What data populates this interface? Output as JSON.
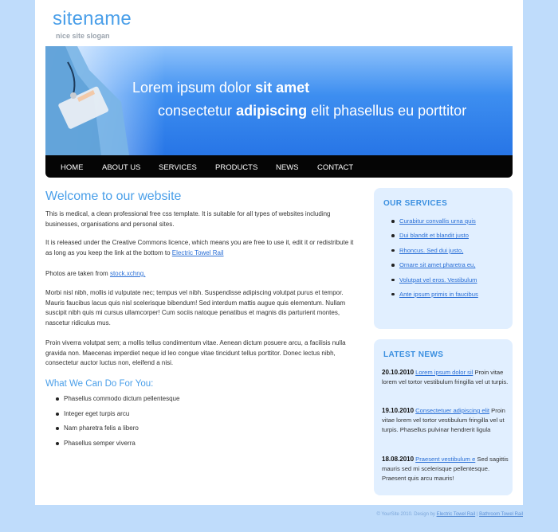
{
  "header": {
    "site_name": "sitename",
    "slogan": "nice site slogan"
  },
  "banner": {
    "line1_prefix": "Lorem ipsum dolor ",
    "line1_bold": "sit amet",
    "line2_prefix": "consectetur ",
    "line2_bold": "adipiscing",
    "line2_suffix": " elit phasellus eu porttitor"
  },
  "nav": {
    "items": [
      "HOME",
      "ABOUT US",
      "SERVICES",
      "PRODUCTS",
      "NEWS",
      "CONTACT"
    ]
  },
  "main": {
    "title": "Welcome to our website",
    "p1": "This is medical, a clean professional free css template. It is suitable for all types of websites including businesses, organisations and personal sites.",
    "p2_text": "It is released under the Creative Commons licence, which means you are free to use it, edit it or redistribute it as long as you keep the link at the bottom to ",
    "p2_link": "Electric Towel Rail",
    "p3_text": "Photos are taken from ",
    "p3_link": "stock.xchng.",
    "p4": "Morbi nisl nibh, mollis id vulputate nec; tempus vel nibh. Suspendisse adipiscing volutpat purus et tempor. Mauris faucibus lacus quis nisl scelerisque bibendum! Sed interdum mattis augue quis elementum. Nullam suscipit nibh quis mi cursus ullamcorper! Cum sociis natoque penatibus et magnis dis parturient montes, nascetur ridiculus mus.",
    "p5": "Proin viverra volutpat sem; a mollis tellus condimentum vitae. Aenean dictum posuere arcu, a facilisis nulla gravida non. Maecenas imperdiet neque id leo congue vitae tincidunt tellus porttitor. Donec lectus nibh, consectetur auctor luctus non, eleifend a nisi.",
    "subhead": "What We Can Do For You:",
    "bullets": [
      "Phasellus commodo dictum pellentesque",
      "Integer eget turpis arcu",
      "Nam pharetra felis a libero",
      "Phasellus semper viverra"
    ]
  },
  "services": {
    "title": "OUR SERVICES",
    "items": [
      "Curabitur convallis urna quis",
      "Dui blandit et blandit justo",
      "Rhoncus. Sed dui justo,",
      "Ornare sit amet pharetra eu,",
      "Volutpat vel eros. Vestibulum",
      "Ante ipsum primis in faucibus"
    ]
  },
  "news": {
    "title": "LATEST NEWS",
    "items": [
      {
        "date": "20.10.2010",
        "link": "Lorem ipsum dolor sil",
        "text": " Proin vitae lorem vel tortor vestibulum fringilla vel ut turpis."
      },
      {
        "date": "19.10.2010",
        "link": "Consectetuer adipiscing elit",
        "text": " Proin vitae lorem vel tortor vestibulum fringilla vel ut turpis. Phasellus pulvinar hendrerit ligula"
      },
      {
        "date": "18.08.2010",
        "link": "Praesent vestibulum e",
        "text": " Sed sagittis mauris sed mi scelerisque pellentesque. Praesent quis arcu mauris!"
      }
    ]
  },
  "footer": {
    "copyright": "© YourSite 2010. Design by ",
    "link1": "Electric Towel Rail",
    "sep": " | ",
    "link2": "Bathroom Towel Rail"
  },
  "colors": {
    "page_bg": "#bfdcfb",
    "accent": "#4a9fe9",
    "nav_bg": "#050505",
    "sidebar_bg": "#e1efff"
  }
}
